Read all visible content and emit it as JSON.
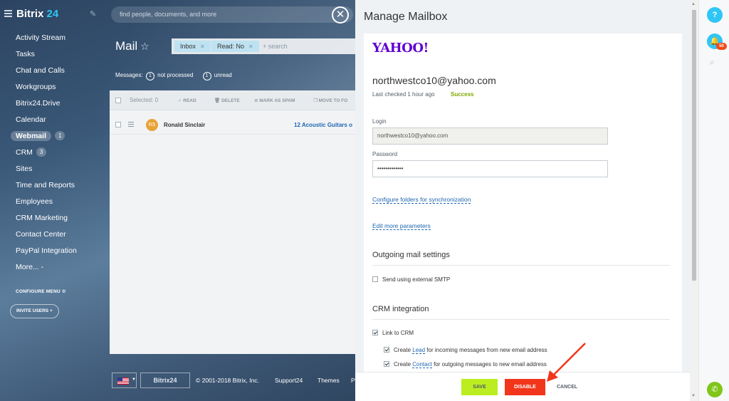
{
  "sidebar": {
    "logo_main": "Bitrix",
    "logo_accent": "24",
    "items": [
      {
        "label": "Activity Stream"
      },
      {
        "label": "Tasks"
      },
      {
        "label": "Chat and Calls"
      },
      {
        "label": "Workgroups"
      },
      {
        "label": "Bitrix24.Drive"
      },
      {
        "label": "Calendar"
      },
      {
        "label": "Webmail",
        "badge": "1"
      },
      {
        "label": "CRM",
        "badge": "3"
      },
      {
        "label": "Sites"
      },
      {
        "label": "Time and Reports"
      },
      {
        "label": "Employees"
      },
      {
        "label": "CRM Marketing"
      },
      {
        "label": "Contact Center"
      },
      {
        "label": "PayPal Integration"
      },
      {
        "label": "More... -"
      }
    ],
    "configure_menu": "CONFIGURE MENU",
    "invite_users": "INVITE USERS"
  },
  "top_search": {
    "placeholder": "find people, documents, and more"
  },
  "mail": {
    "title": "Mail",
    "filter_chips": [
      "Inbox",
      "Read: No"
    ],
    "filter_search": "+ search",
    "status_prefix": "Messages:",
    "not_processed_count": "1",
    "not_processed_label": "not processed",
    "unread_count": "1",
    "unread_label": "unread",
    "toolbar": {
      "selected": "Selected: 0",
      "read": "READ",
      "delete": "DELETE",
      "spam": "MARK AS SPAM",
      "move": "MOVE TO FO"
    },
    "rows": [
      {
        "avatar": "RS",
        "sender": "Ronald Sinclair",
        "subject": "12 Acoustic Guitars o"
      }
    ]
  },
  "footer": {
    "b24": "Bitrix24",
    "copyright": "© 2001-2018 Bitrix, Inc.",
    "support": "Support24",
    "themes": "Themes",
    "p": "P"
  },
  "mailbox": {
    "title": "Manage Mailbox",
    "provider_logo": "YAHOO!",
    "email": "northwestco10@yahoo.com",
    "last_checked": "Last checked 1 hour ago",
    "status": "Success",
    "login_label": "Login",
    "login_value": "northwestco10@yahoo.com",
    "password_label": "Password",
    "password_value": "•••••••••••••",
    "configure_folders": "Configure folders for synchronization",
    "edit_params": "Edit more parameters",
    "outgoing_title": "Outgoing mail settings",
    "smtp_label": "Send using external SMTP",
    "crm_title": "CRM integration",
    "link_crm": "Link to CRM",
    "create_prefix": "Create",
    "lead": "Lead",
    "lead_suffix": "for incoming messages from new email address",
    "contact": "Contact",
    "contact_suffix": "for outgoing messages to new email address",
    "save": "SAVE",
    "disable": "DISABLE",
    "cancel": "CANCEL"
  },
  "right_panel": {
    "help": "?",
    "notifications": "50"
  },
  "colors": {
    "accent": "#2fc6f6",
    "save": "#bbed21",
    "disable": "#f1361b",
    "success": "#7fa800",
    "yahoo": "#5f01d1"
  }
}
